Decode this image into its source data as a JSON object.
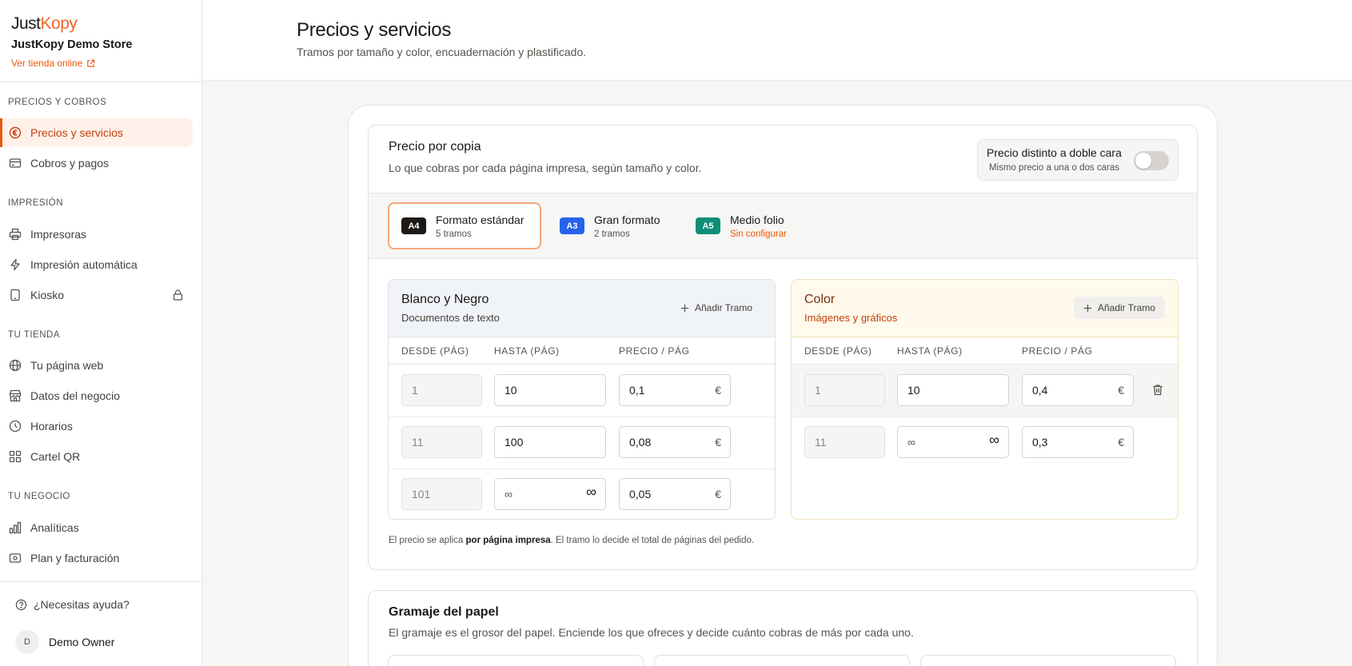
{
  "sidebar": {
    "brand_a": "Just",
    "brand_b": "Kopy",
    "store_name": "JustKopy Demo Store",
    "store_link": "Ver tienda online",
    "sections": [
      {
        "title": "PRECIOS Y COBROS",
        "items": [
          {
            "label": "Precios y servicios",
            "icon": "euro-icon",
            "active": true
          },
          {
            "label": "Cobros y pagos",
            "icon": "credit-card-icon"
          }
        ]
      },
      {
        "title": "IMPRESIÓN",
        "items": [
          {
            "label": "Impresoras",
            "icon": "printer-icon"
          },
          {
            "label": "Impresión automática",
            "icon": "lightning-icon"
          },
          {
            "label": "Kiosko",
            "icon": "tablet-icon",
            "locked": true
          }
        ]
      },
      {
        "title": "TU TIENDA",
        "items": [
          {
            "label": "Tu página web",
            "icon": "globe-icon"
          },
          {
            "label": "Datos del negocio",
            "icon": "store-icon"
          },
          {
            "label": "Horarios",
            "icon": "clock-icon"
          },
          {
            "label": "Cartel QR",
            "icon": "qr-icon"
          }
        ]
      },
      {
        "title": "TU NEGOCIO",
        "items": [
          {
            "label": "Analíticas",
            "icon": "bar-chart-icon"
          },
          {
            "label": "Plan y facturación",
            "icon": "billing-icon"
          }
        ]
      }
    ],
    "help": "¿Necesitas ayuda?",
    "user_initial": "D",
    "user_name": "Demo Owner"
  },
  "header": {
    "title": "Precios y servicios",
    "subtitle": "Tramos por tamaño y color, encuadernación y plastificado."
  },
  "price_card": {
    "title": "Precio por copia",
    "subtitle": "Lo que cobras por cada página impresa, según tamaño y color.",
    "duplex_title": "Precio distinto a doble cara",
    "duplex_sub": "Mismo precio a una o dos caras",
    "duplex_on": false,
    "formats": [
      {
        "badge": "A4",
        "name": "Formato estándar",
        "count": "5 tramos",
        "active": true,
        "color": "#1c1917"
      },
      {
        "badge": "A3",
        "name": "Gran formato",
        "count": "2 tramos",
        "color": "#2563eb"
      },
      {
        "badge": "A5",
        "name": "Medio folio",
        "count": "Sin configurar",
        "warn": true,
        "color": "#0f8f76"
      }
    ],
    "headers": {
      "from": "DESDE (PÁG)",
      "to": "HASTA (PÁG)",
      "price": "PRECIO / PÁG"
    },
    "add_label": "Añadir Tramo",
    "currency": "€",
    "infinity": "∞",
    "bw": {
      "title": "Blanco y Negro",
      "subtitle": "Documentos de texto",
      "rows": [
        {
          "from": "1",
          "to": "10",
          "price": "0,1"
        },
        {
          "from": "11",
          "to": "100",
          "price": "0,08"
        },
        {
          "from": "101",
          "to": "∞",
          "price": "0,05",
          "open": true
        }
      ]
    },
    "color": {
      "title": "Color",
      "subtitle": "Imágenes y gráficos",
      "rows": [
        {
          "from": "1",
          "to": "10",
          "price": "0,4"
        },
        {
          "from": "11",
          "to": "∞",
          "price": "0,3",
          "open": true
        }
      ]
    },
    "note_a": "El precio se aplica ",
    "note_b": "por página impresa",
    "note_c": ". El tramo lo decide el total de páginas del pedido."
  },
  "paper_card": {
    "title": "Gramaje del papel",
    "subtitle": "El gramaje es el grosor del papel. Enciende los que ofreces y decide cuánto cobras de más por cada uno."
  },
  "colors": {
    "accent": "#ea580c",
    "brand": "#f2652a"
  }
}
